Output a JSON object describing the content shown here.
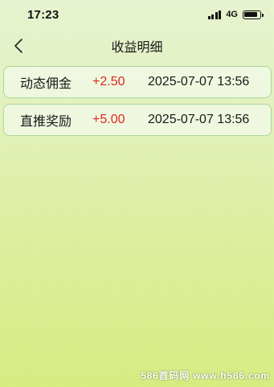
{
  "status_bar": {
    "time": "17:23",
    "network": "4G",
    "signal_icon": "cellular-signal-icon",
    "battery_icon": "battery-icon",
    "battery_level": 0.85
  },
  "nav": {
    "title": "收益明细",
    "back_icon": "chevron-left-icon"
  },
  "records": [
    {
      "type": "动态佣金",
      "amount": "+2.50",
      "time": "2025-07-07 13:56"
    },
    {
      "type": "直推奖励",
      "amount": "+5.00",
      "time": "2025-07-07 13:56"
    }
  ],
  "watermark": "586首码网 www.h586.com",
  "colors": {
    "amount": "#e0261e",
    "card_border": "#a9d89a",
    "background_top": "#e6f3cf",
    "background_bottom": "#d6ec80"
  }
}
